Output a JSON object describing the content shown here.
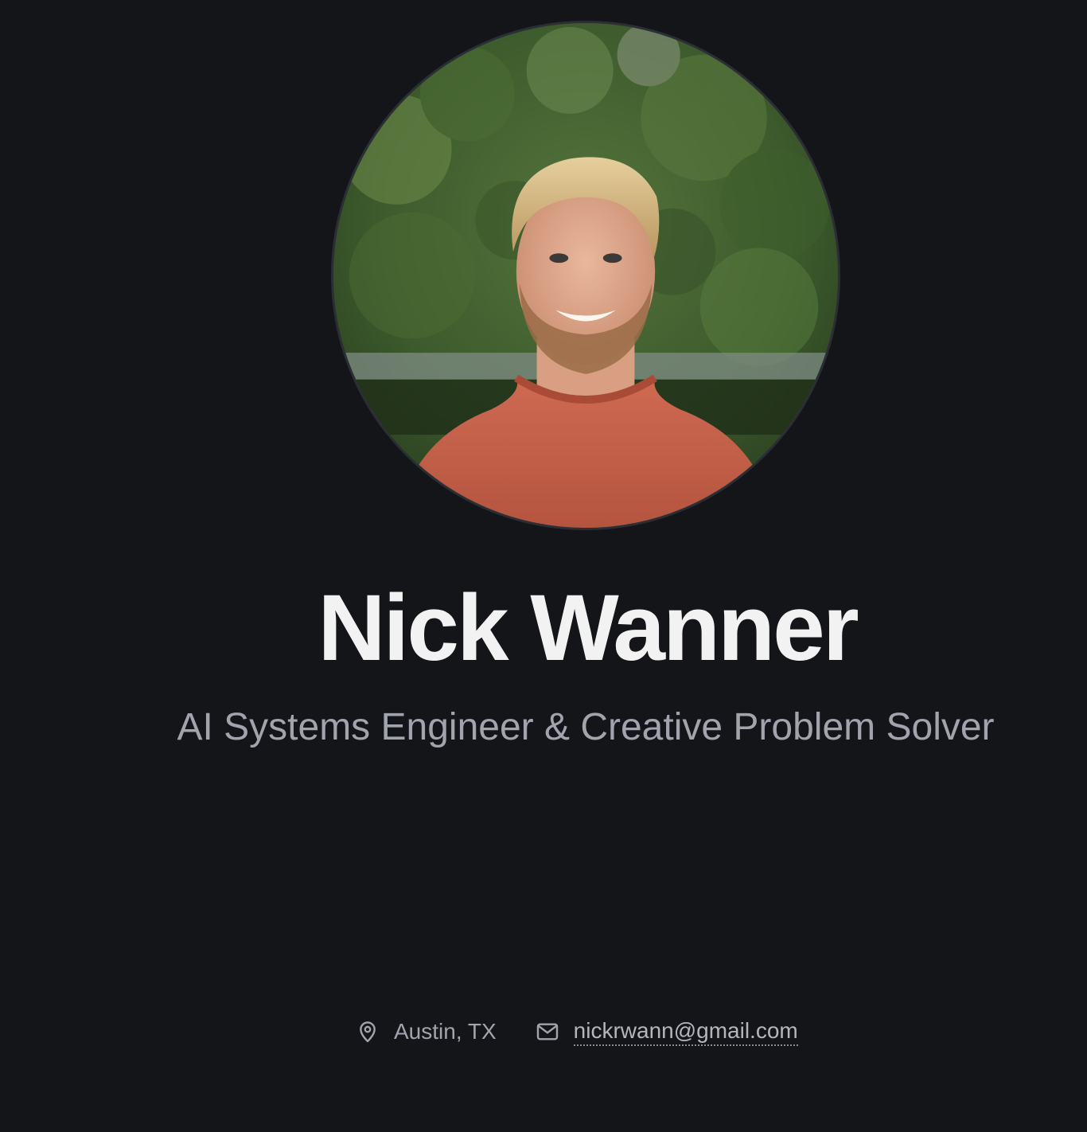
{
  "profile": {
    "name": "Nick Wanner",
    "tagline": "AI Systems Engineer & Creative Problem Solver",
    "photo_alt": "Nick Wanner"
  },
  "contact": {
    "location": "Austin, TX",
    "location_icon": "map-pin-icon",
    "email": "nickrwann@gmail.com",
    "email_icon": "mail-icon",
    "email_href": "mailto:nickrwann@gmail.com"
  },
  "colors": {
    "background": "#141519",
    "name_text": "#f2f2f3",
    "muted_text": "#a1a3ad"
  }
}
